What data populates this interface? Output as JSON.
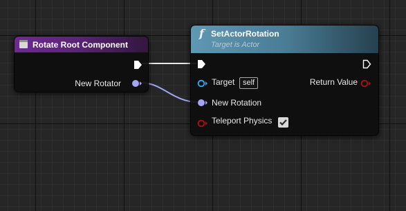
{
  "colors": {
    "graph_background": "#262626",
    "exec_pin": "#ffffff",
    "rotator_pin": "#a3a6f5",
    "object_pin": "#2aa5e8",
    "bool_pin": "#a11313",
    "function_header": "#4a7d96",
    "event_header": "#6e2a91"
  },
  "nodes": {
    "rotate_root": {
      "icon": "component-icon",
      "title": "Rotate Root Component",
      "outputs": {
        "new_rotator": "New Rotator"
      }
    },
    "set_actor_rotation": {
      "icon": "function-icon",
      "icon_glyph": "f",
      "title": "SetActorRotation",
      "subtitle": "Target is Actor",
      "inputs": {
        "target": "Target",
        "target_default": "self",
        "new_rotation": "New Rotation",
        "teleport_physics": "Teleport Physics",
        "teleport_physics_checked": true
      },
      "outputs": {
        "return_value": "Return Value"
      }
    }
  }
}
